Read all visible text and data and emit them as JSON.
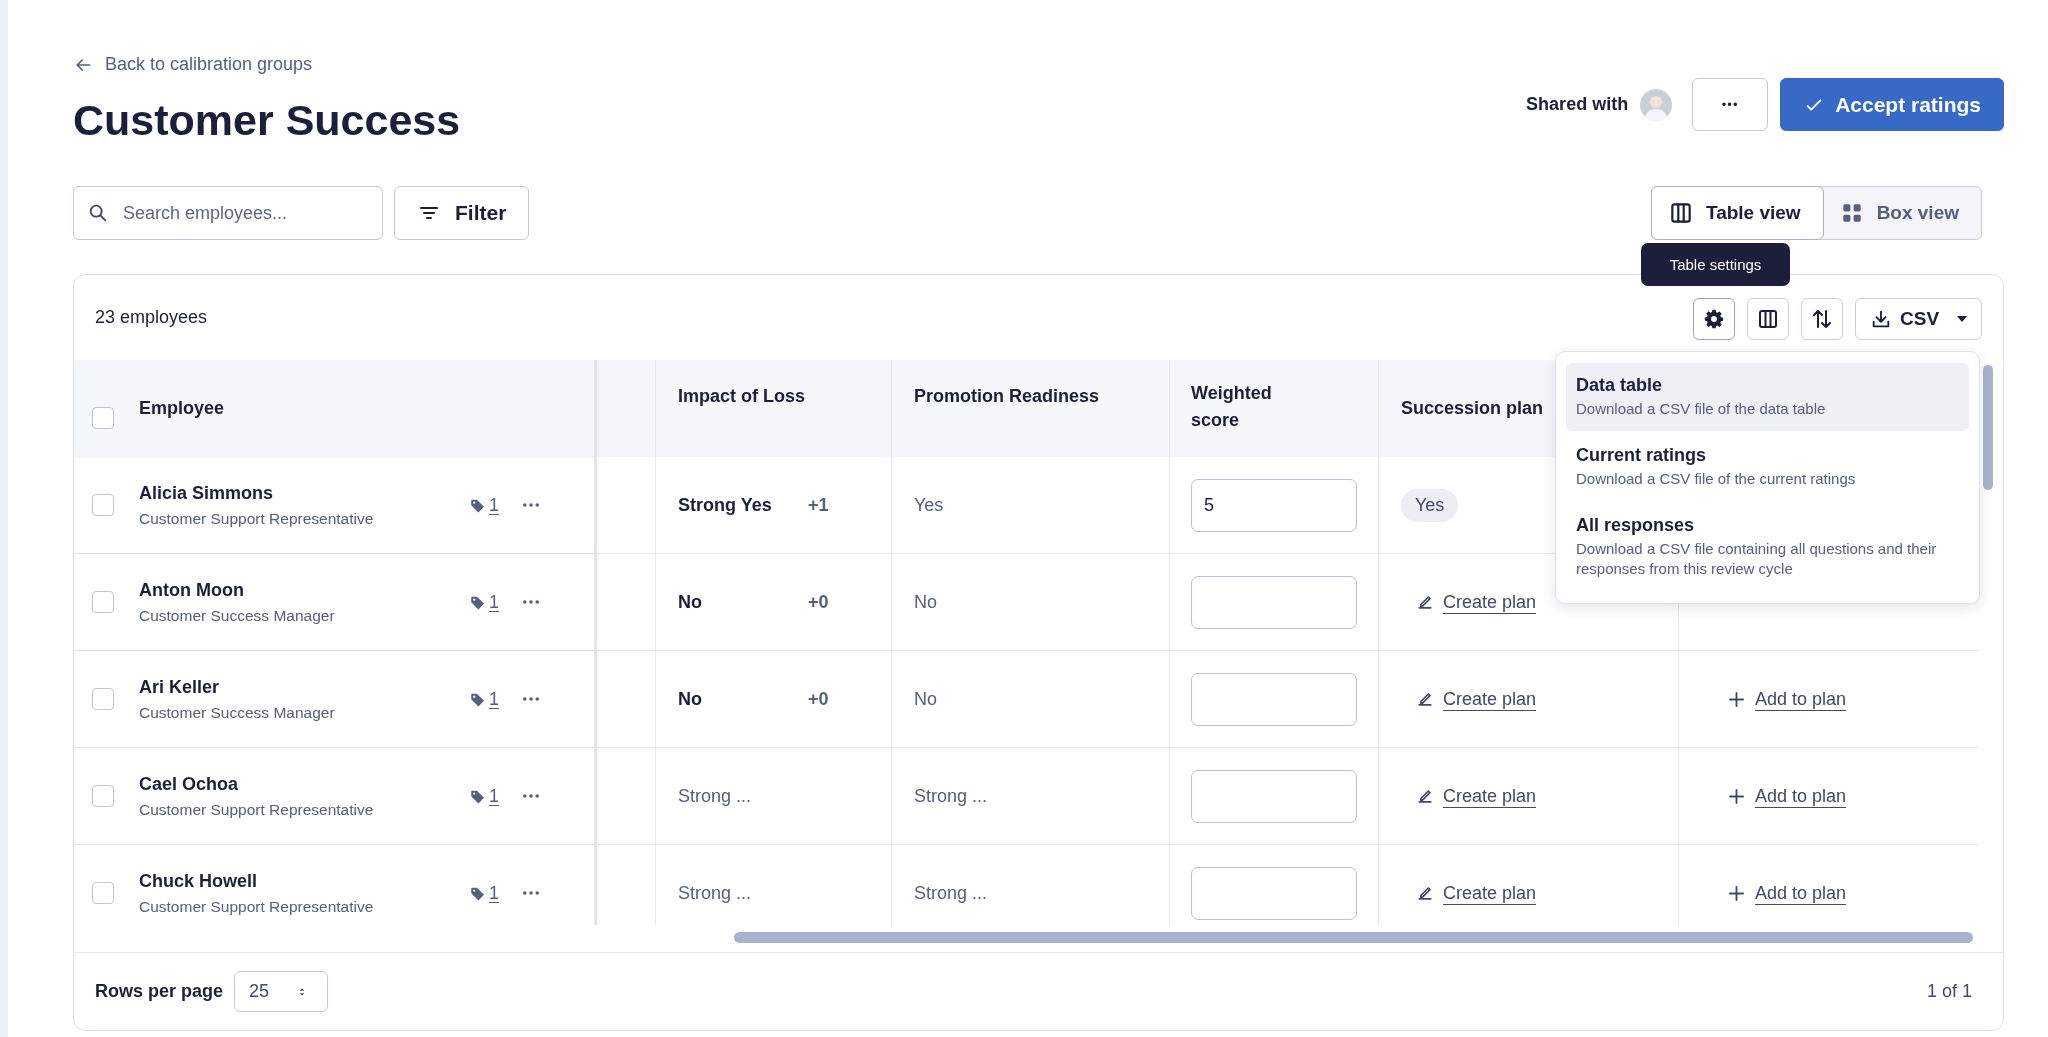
{
  "back_link": {
    "label": "Back to calibration groups"
  },
  "title": "Customer Success",
  "shared_with": {
    "label": "Shared with"
  },
  "more_button": {
    "label": "•••"
  },
  "accept_button": {
    "label": "Accept ratings"
  },
  "search": {
    "placeholder": "Search employees..."
  },
  "filter_button": {
    "label": "Filter"
  },
  "views": [
    {
      "label": "Table view",
      "kind": "table",
      "selected": true
    },
    {
      "label": "Box view",
      "kind": "box",
      "selected": false
    }
  ],
  "tooltip": {
    "text": "Table settings"
  },
  "table_toolbar": {
    "count": "23 employees",
    "export_label": "CSV"
  },
  "columns": [
    {
      "label": "Employee",
      "kind": "employee"
    },
    {
      "kind": "spacer"
    },
    {
      "label": "Impact of Loss",
      "kind": "impact"
    },
    {
      "label": "Promotion Readiness",
      "kind": "text"
    },
    {
      "label": "Weighted score",
      "kind": "score"
    },
    {
      "label": "Succession plan",
      "kind": "succession"
    },
    {
      "kind": "plan"
    }
  ],
  "header_checkbox": {
    "checked": false
  },
  "rows": [
    {
      "name": "Alicia Simmons",
      "job": "Customer Support Representative",
      "checked": false,
      "tags": "1",
      "impact": {
        "value": "Strong Yes",
        "adjustment": "+1",
        "calibrated": true
      },
      "promotion": "Yes",
      "score": "5",
      "succession": {
        "kind": "badge",
        "label": "Yes"
      }
    },
    {
      "name": "Anton Moon",
      "job": "Customer Success Manager",
      "checked": false,
      "tags": "1",
      "impact": {
        "value": "No",
        "adjustment": "+0",
        "calibrated": true
      },
      "promotion": "No",
      "score": "",
      "succession": {
        "kind": "link",
        "label": "Create plan"
      }
    },
    {
      "name": "Ari Keller",
      "job": "Customer Success Manager",
      "checked": false,
      "tags": "1",
      "impact": {
        "value": "No",
        "adjustment": "+0",
        "calibrated": true
      },
      "promotion": "No",
      "score": "",
      "succession": {
        "kind": "link",
        "label": "Create plan"
      },
      "plan": "Add to plan"
    },
    {
      "name": "Cael Ochoa",
      "job": "Customer Support Representative",
      "checked": false,
      "tags": "1",
      "impact": {
        "value": "Strong ...",
        "calibrated": false
      },
      "promotion": "Strong ...",
      "score": "",
      "succession": {
        "kind": "link",
        "label": "Create plan"
      },
      "plan": "Add to plan"
    },
    {
      "name": "Chuck Howell",
      "job": "Customer Support Representative",
      "checked": false,
      "tags": "1",
      "impact": {
        "value": "Strong ...",
        "calibrated": false
      },
      "promotion": "Strong ...",
      "score": "",
      "succession": {
        "kind": "link",
        "label": "Create plan"
      },
      "plan": "Add to plan"
    }
  ],
  "csv_menu": [
    {
      "title": "Data table",
      "description": "Download a CSV file of the data table",
      "selected": true
    },
    {
      "title": "Current ratings",
      "description": "Download a CSV file of the current ratings",
      "selected": false
    },
    {
      "title": "All responses",
      "description": "Download a CSV file containing all questions and their responses from this review cycle",
      "selected": false
    }
  ],
  "footer": {
    "rows_label": "Rows per page",
    "rows_value": "25",
    "pages": "1 of 1"
  }
}
